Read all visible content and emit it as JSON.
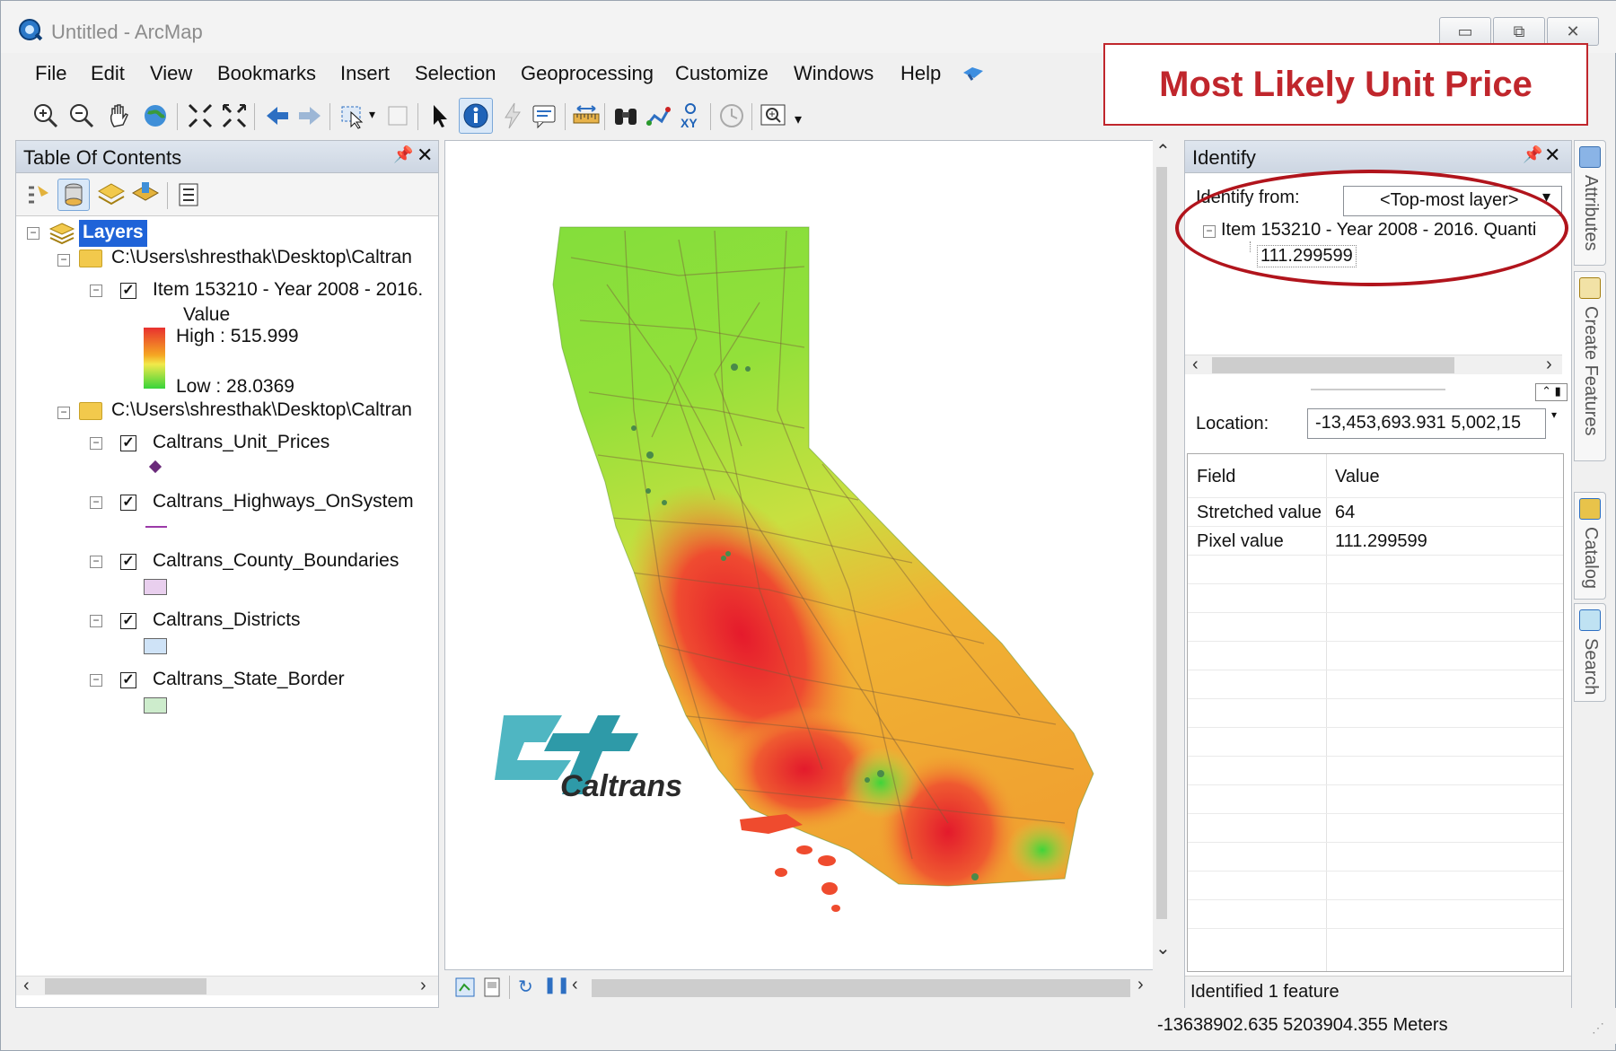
{
  "window": {
    "title": "Untitled - ArcMap",
    "minimize": "▭",
    "maximize": "⧉",
    "close": "✕"
  },
  "menu": [
    "File",
    "Edit",
    "View",
    "Bookmarks",
    "Insert",
    "Selection",
    "Geoprocessing",
    "Customize",
    "Windows",
    "Help"
  ],
  "callout": "Most Likely Unit Price",
  "toolbar_icons": [
    "zoom-in-icon",
    "zoom-out-icon",
    "pan-icon",
    "full-extent-icon",
    "fixed-zoom-in-icon",
    "fixed-zoom-out-icon",
    "back-extent-icon",
    "forward-extent-icon",
    "select-features-icon",
    "clear-selection-icon",
    "select-elements-icon",
    "identify-icon",
    "hyperlink-icon",
    "html-popup-icon",
    "measure-icon",
    "find-icon",
    "find-route-icon",
    "go-to-xy-icon",
    "time-slider-icon",
    "viewer-window-icon"
  ],
  "toc": {
    "title": "Table Of Contents",
    "root": "Layers",
    "group1_path": "C:\\Users\\shresthak\\Desktop\\Caltran",
    "raster_layer": "Item 153210 -   Year 2008 - 2016.",
    "legend_value": "Value",
    "legend_high": "High : 515.999",
    "legend_low": "Low : 28.0369",
    "group2_path": "C:\\Users\\shresthak\\Desktop\\Caltran",
    "layers": [
      {
        "name": "Caltrans_Unit_Prices",
        "symbol": "#6a2a7a"
      },
      {
        "name": "Caltrans_Highways_OnSystem",
        "symbol": "#9b3aa8"
      },
      {
        "name": "Caltrans_County_Boundaries",
        "symbol": "#e9cfee"
      },
      {
        "name": "Caltrans_Districts",
        "symbol": "#cfe3f7"
      },
      {
        "name": "Caltrans_State_Border",
        "symbol": "#cdeccc"
      }
    ]
  },
  "map": {
    "logo_text": "Caltrans"
  },
  "identify": {
    "title": "Identify",
    "from_label": "Identify from:",
    "from_value": "<Top-most layer>",
    "result_item": "Item 153210 -   Year 2008 - 2016.  Quanti",
    "result_value": "111.299599",
    "location_label": "Location:",
    "location_value": "-13,453,693.931  5,002,15",
    "field_header": "Field",
    "value_header": "Value",
    "rows": [
      {
        "field": "Stretched value",
        "value": "64"
      },
      {
        "field": "Pixel value",
        "value": "111.299599"
      }
    ],
    "footer": "Identified 1 feature"
  },
  "dock_tabs": [
    "Attributes",
    "Create Features",
    "Catalog",
    "Search"
  ],
  "status_coords": "-13638902.635  5203904.355 Meters"
}
